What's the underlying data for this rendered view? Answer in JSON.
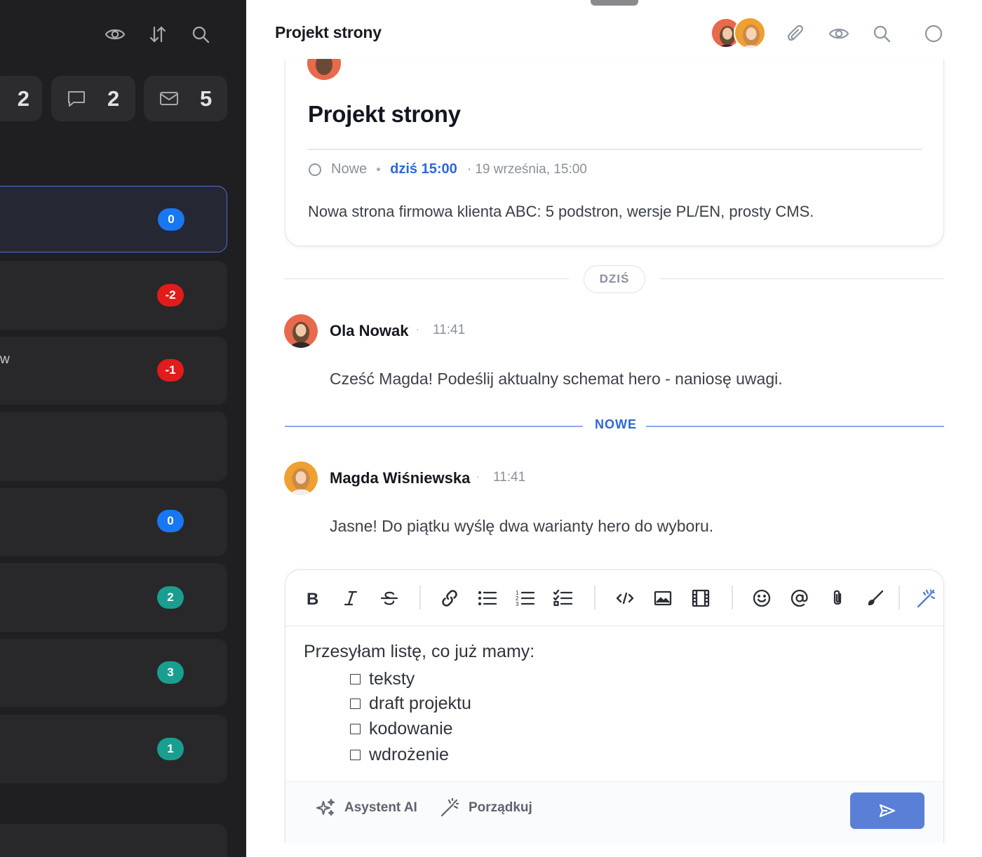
{
  "sidebar": {
    "stats": [
      {
        "value": "2",
        "icon": "unknown-icon"
      },
      {
        "value": "2",
        "icon": "comment-icon"
      },
      {
        "value": "5",
        "icon": "mail-icon"
      }
    ],
    "cards": [
      {
        "badge": "0",
        "badge_color": "#1877f2",
        "active": true
      },
      {
        "badge": "-2",
        "badge_color": "#e21b1b"
      },
      {
        "badge": "-1",
        "badge_color": "#e21b1b",
        "fragment": "w"
      },
      {
        "badge": ""
      },
      {
        "badge": "0",
        "badge_color": "#1877f2"
      },
      {
        "badge": "2",
        "badge_color": "#1a9e8f"
      },
      {
        "badge": "3",
        "badge_color": "#1a9e8f"
      },
      {
        "badge": "1",
        "badge_color": "#1a9e8f"
      }
    ]
  },
  "header": {
    "title": "Projekt strony"
  },
  "task": {
    "title": "Projekt strony",
    "status": "Nowe",
    "due_relative": "dziś 15:00",
    "due_absolute": "· 19 września, 15:00",
    "description": "Nowa strona firmowa klienta ABC: 5 podstron, wersje PL/EN, prosty CMS."
  },
  "divider": {
    "day_label": "DZIŚ",
    "new_label": "NOWE"
  },
  "messages": [
    {
      "author": "Ola Nowak",
      "time": "11:41",
      "text": "Cześć Magda! Podeślij aktualny schemat hero - naniosę uwagi."
    },
    {
      "author": "Magda Wiśniewska",
      "time": "11:41",
      "text": "Jasne! Do piątku wyślę dwa warianty hero do wyboru."
    }
  ],
  "composer": {
    "intro": "Przesyłam listę, co już mamy:",
    "checklist": [
      "teksty",
      "draft projektu",
      "kodowanie",
      "wdrożenie"
    ],
    "ai_assistant_label": "Asystent AI",
    "tidy_label": "Porządkuj"
  },
  "colors": {
    "accent": "#2e67d8",
    "send_button": "#5a7fd6",
    "sidebar_bg": "#1f1f21"
  }
}
